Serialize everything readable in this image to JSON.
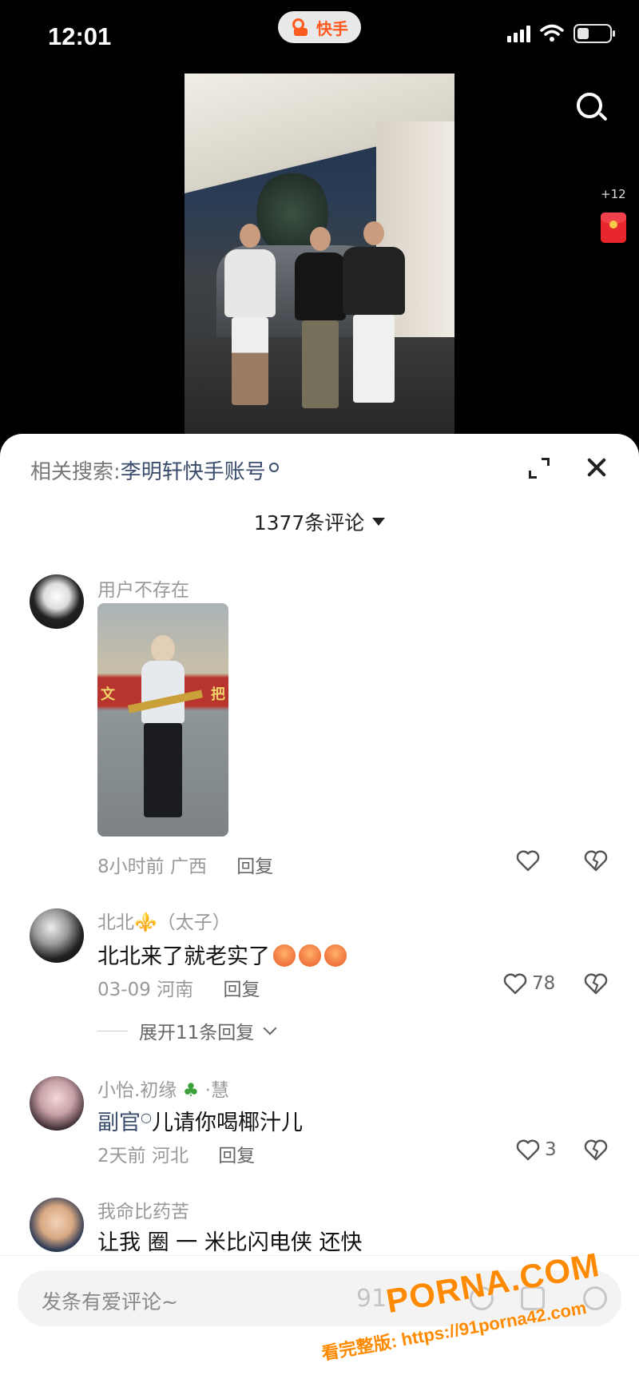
{
  "status_bar": {
    "time": "12:01",
    "app_name": "快手"
  },
  "video": {
    "reward_count": "+12"
  },
  "sheet": {
    "related_label": "相关搜索:",
    "related_query": "李明轩快手账号",
    "comment_count": "1377条评论"
  },
  "comments": [
    {
      "user": "用户不存在",
      "photo_banner": [
        "文",
        "把"
      ],
      "time": "8小时前",
      "location": "广西",
      "reply": "回复"
    },
    {
      "user": "北北⚜️（太子）",
      "text": "北北来了就老实了",
      "time": "03-09",
      "location": "河南",
      "reply": "回复",
      "likes": "78",
      "expand": "展开11条回复"
    },
    {
      "user": "小怡.初缘",
      "user_suffix": "·慧",
      "text_link": "副官",
      "text": "儿请你喝椰汁儿",
      "time": "2天前",
      "location": "河北",
      "reply": "回复",
      "likes": "3"
    },
    {
      "user": "我命比药苦",
      "text": "让我 圈 一 米比闪电侠 还快"
    }
  ],
  "input": {
    "placeholder": "发条有爱评论~"
  },
  "watermark": {
    "brand": "PORNA.COM",
    "ghost": "91",
    "line": "看完整版: https://91porna42.com"
  },
  "icons": [
    "kuaishou-logo-icon",
    "signal-icon",
    "wifi-icon",
    "battery-icon",
    "search-icon",
    "red-packet-icon",
    "expand-icon",
    "close-icon",
    "dropdown-icon",
    "heart-icon",
    "dislike-icon",
    "chevron-down-icon",
    "emoji-icon",
    "image-icon",
    "sticker-icon"
  ],
  "colors": {
    "accent": "#ff5a1f",
    "link": "#3b4d6d",
    "watermark": "#ff8a00"
  }
}
